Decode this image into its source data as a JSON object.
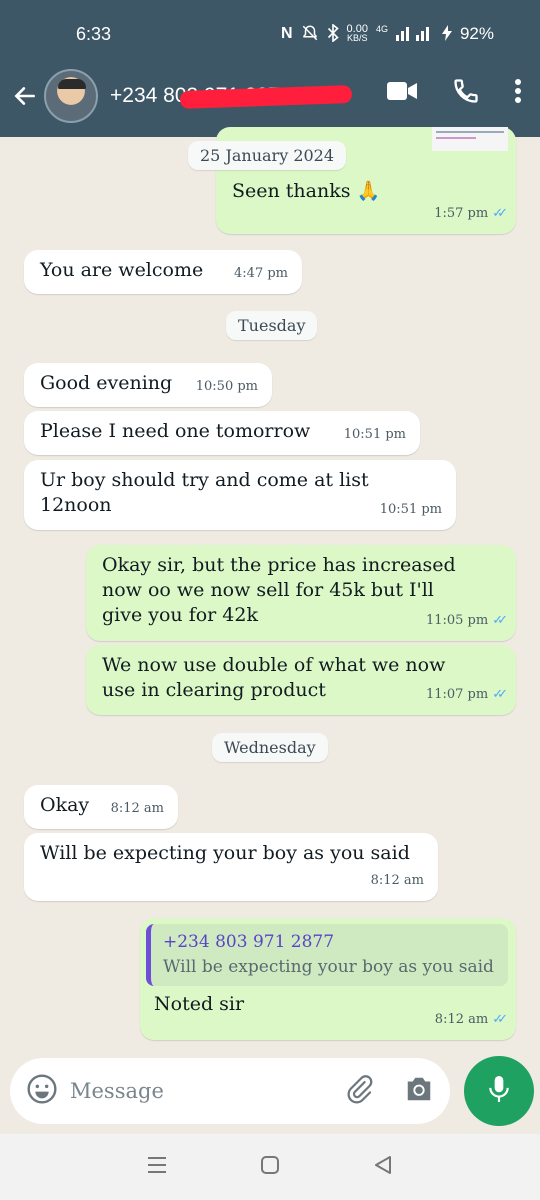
{
  "status_bar": {
    "time": "6:33",
    "nfc": "N",
    "data_speed": "0.00",
    "data_unit": "KB/S",
    "network": "4G",
    "battery": "92%"
  },
  "header": {
    "contact_name": "+234 803 971 2877"
  },
  "chat": {
    "top_out": {
      "text": "Seen thanks 🙏",
      "time": "1:57 pm"
    },
    "date_chip_1": "25 January 2024",
    "msg_1": {
      "text": "You are welcome",
      "time": "4:47 pm"
    },
    "date_chip_2": "Tuesday",
    "msg_2": {
      "text": "Good evening",
      "time": "10:50 pm"
    },
    "msg_3": {
      "text": "Please I need one tomorrow",
      "time": "10:51 pm"
    },
    "msg_4": {
      "text": "Ur boy should try and come at list 12noon",
      "time": "10:51 pm"
    },
    "msg_5": {
      "text": "Okay sir, but the price has increased now oo we now sell for 45k but I'll give you for 42k",
      "time": "11:05 pm"
    },
    "msg_6": {
      "text": "We now use double of what we now use in clearing product",
      "time": "11:07 pm"
    },
    "date_chip_3": "Wednesday",
    "msg_7": {
      "text": "Okay",
      "time": "8:12 am"
    },
    "msg_8": {
      "text": "Will be expecting your boy as you said",
      "time": "8:12 am"
    },
    "msg_9": {
      "quote_name": "+234 803 971 2877",
      "quote_text": "Will be expecting your boy as you said",
      "text": "Noted sir",
      "time": "8:12 am"
    }
  },
  "composer": {
    "placeholder": "Message"
  },
  "colors": {
    "header": "#3e5766",
    "incoming": "#ffffff",
    "outgoing": "#dcf8c6",
    "chat_bg": "#efeae2",
    "mic": "#1fa162",
    "read_ticks": "#4fa8ff"
  }
}
